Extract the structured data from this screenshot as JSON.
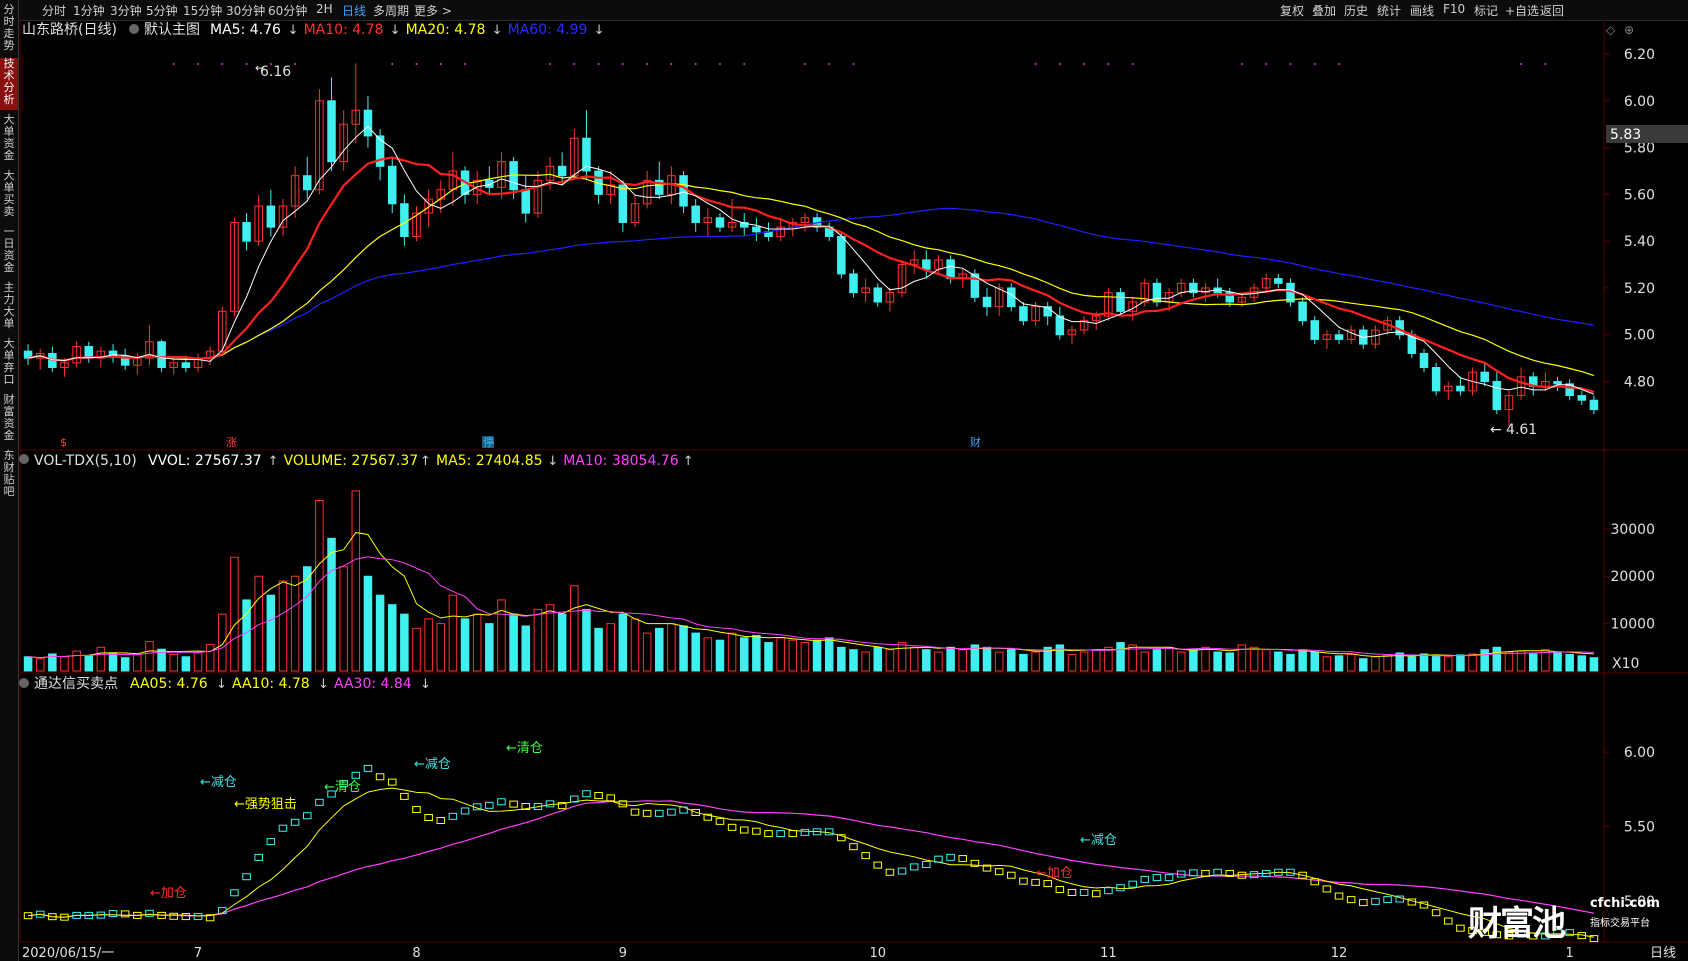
{
  "toolbar": {
    "timeframes": [
      "分时",
      "1分钟",
      "3分钟",
      "5分钟",
      "15分钟",
      "30分钟",
      "60分钟",
      "2H",
      "日线",
      "多周期",
      "更多 >"
    ],
    "active_timeframe": "日线",
    "right_buttons": [
      "复权",
      "叠加",
      "历史",
      "统计",
      "画线",
      "F10",
      "标记",
      "+自选",
      "返回"
    ]
  },
  "sidebar": {
    "tabs": [
      "分时走势",
      "技术分析",
      "大单资金",
      "大单买卖",
      "一日资金",
      "主力大单",
      "大单弃口",
      "财富资金",
      "东财贴吧"
    ],
    "active_tab": "技术分析"
  },
  "main_panel": {
    "stock_label": "山东路桥(日线)",
    "template": "默认主图",
    "indicators": [
      {
        "text": "MA5: 4.76",
        "arrow": "↓",
        "color": "#ffffff"
      },
      {
        "text": "MA10: 4.78",
        "arrow": "↓",
        "color": "#ff3030"
      },
      {
        "text": "MA20: 4.78",
        "arrow": "↓",
        "color": "#ffff00"
      },
      {
        "text": "MA60: 4.99",
        "arrow": "↓",
        "color": "#2b2bff"
      }
    ],
    "high_label": "6.16",
    "low_label": "4.61",
    "current_price": "5.83",
    "price_ticks": [
      "6.20",
      "6.00",
      "5.80",
      "5.60",
      "5.40",
      "5.20",
      "5.00",
      "4.80"
    ],
    "event_markers": [
      {
        "label": "$",
        "color": "#ff4040"
      },
      {
        "label": "涨",
        "color": "#ff4040"
      },
      {
        "label": "停",
        "color": "#40c0ff"
      },
      {
        "label": "财",
        "color": "#40a0ff"
      }
    ]
  },
  "volume_panel": {
    "title": "VOL-TDX(5,10)",
    "indicators": [
      {
        "text": "VVOL: 27567.37",
        "arrow": "↑",
        "color": "#ffffff"
      },
      {
        "text": "VOLUME: 27567.37",
        "arrow": "↑",
        "color": "#ffff00"
      },
      {
        "text": "MA5: 27404.85",
        "arrow": "↓",
        "color": "#ffff00"
      },
      {
        "text": "MA10: 38054.76",
        "arrow": "↑",
        "color": "#ff40ff"
      }
    ],
    "ticks": [
      "30000",
      "20000",
      "10000"
    ],
    "unit": "X10"
  },
  "signal_panel": {
    "title": "通达信买卖点",
    "indicators": [
      {
        "text": "AA05: 4.76",
        "arrow": "↓",
        "color": "#ffff00"
      },
      {
        "text": "AA10: 4.78",
        "arrow": "↓",
        "color": "#ffff00"
      },
      {
        "text": "AA30: 4.84",
        "arrow": "↓",
        "color": "#ff40ff"
      }
    ],
    "ticks": [
      "6.00",
      "5.50",
      "5.00"
    ],
    "annotations": [
      {
        "text": "←加仓",
        "color": "#ff3030"
      },
      {
        "text": "←减仓",
        "color": "#40e0e0"
      },
      {
        "text": "←强势狙击",
        "color": "#ffff00"
      },
      {
        "text": "←清仓",
        "color": "#40ff40"
      },
      {
        "text": "←减仓",
        "color": "#40e0e0"
      },
      {
        "text": "←清仓",
        "color": "#40ff40"
      },
      {
        "text": "←加仓",
        "color": "#ff3030"
      },
      {
        "text": "←减仓",
        "color": "#40e0e0"
      }
    ]
  },
  "x_axis": {
    "start_date": "2020/06/15/一",
    "month_labels": [
      "7",
      "8",
      "9",
      "10",
      "11",
      "12",
      "1"
    ],
    "period_label": "日线"
  },
  "watermark": {
    "brand": "财富池",
    "domain": "cfchi.com",
    "tagline": "指标交易平台"
  },
  "colors": {
    "up": "#ff3030",
    "down": "#40f0f0",
    "ma5": "#ffffff",
    "ma10": "#ff2020",
    "ma20": "#ffff00",
    "ma60": "#2020ff",
    "ma_vol10": "#ff40ff",
    "grid": "#5a0000"
  },
  "chart_data": {
    "type": "candlestick",
    "symbol_title": "山东路桥(日线)",
    "ohlc": [
      [
        4.93,
        4.96,
        4.87,
        4.9
      ],
      [
        4.9,
        4.94,
        4.85,
        4.92
      ],
      [
        4.92,
        4.95,
        4.84,
        4.86
      ],
      [
        4.86,
        4.9,
        4.82,
        4.88
      ],
      [
        4.88,
        4.97,
        4.86,
        4.95
      ],
      [
        4.95,
        4.97,
        4.88,
        4.9
      ],
      [
        4.9,
        4.95,
        4.86,
        4.93
      ],
      [
        4.93,
        4.96,
        4.88,
        4.91
      ],
      [
        4.91,
        4.94,
        4.85,
        4.87
      ],
      [
        4.87,
        4.92,
        4.83,
        4.9
      ],
      [
        4.9,
        5.04,
        4.87,
        4.97
      ],
      [
        4.97,
        4.98,
        4.84,
        4.86
      ],
      [
        4.86,
        4.9,
        4.83,
        4.88
      ],
      [
        4.88,
        4.91,
        4.84,
        4.86
      ],
      [
        4.86,
        4.92,
        4.84,
        4.9
      ],
      [
        4.9,
        4.95,
        4.87,
        4.93
      ],
      [
        4.93,
        5.12,
        4.91,
        5.1
      ],
      [
        5.1,
        5.5,
        5.08,
        5.48
      ],
      [
        5.48,
        5.52,
        5.36,
        5.4
      ],
      [
        5.4,
        5.6,
        5.38,
        5.55
      ],
      [
        5.55,
        5.62,
        5.42,
        5.46
      ],
      [
        5.46,
        5.58,
        5.42,
        5.55
      ],
      [
        5.55,
        5.72,
        5.5,
        5.68
      ],
      [
        5.68,
        5.76,
        5.58,
        5.62
      ],
      [
        5.62,
        6.05,
        5.6,
        6.0
      ],
      [
        6.0,
        6.1,
        5.7,
        5.74
      ],
      [
        5.74,
        5.96,
        5.7,
        5.9
      ],
      [
        5.9,
        6.16,
        5.82,
        5.96
      ],
      [
        5.96,
        6.02,
        5.8,
        5.85
      ],
      [
        5.85,
        5.88,
        5.66,
        5.72
      ],
      [
        5.72,
        5.76,
        5.52,
        5.56
      ],
      [
        5.56,
        5.6,
        5.38,
        5.42
      ],
      [
        5.42,
        5.55,
        5.4,
        5.52
      ],
      [
        5.52,
        5.62,
        5.46,
        5.58
      ],
      [
        5.58,
        5.66,
        5.52,
        5.62
      ],
      [
        5.62,
        5.78,
        5.55,
        5.7
      ],
      [
        5.7,
        5.72,
        5.56,
        5.6
      ],
      [
        5.6,
        5.7,
        5.56,
        5.66
      ],
      [
        5.66,
        5.72,
        5.6,
        5.63
      ],
      [
        5.63,
        5.78,
        5.58,
        5.74
      ],
      [
        5.74,
        5.76,
        5.58,
        5.62
      ],
      [
        5.62,
        5.68,
        5.48,
        5.52
      ],
      [
        5.52,
        5.7,
        5.5,
        5.66
      ],
      [
        5.66,
        5.76,
        5.62,
        5.72
      ],
      [
        5.72,
        5.78,
        5.64,
        5.68
      ],
      [
        5.68,
        5.88,
        5.66,
        5.84
      ],
      [
        5.84,
        5.96,
        5.66,
        5.7
      ],
      [
        5.7,
        5.72,
        5.56,
        5.6
      ],
      [
        5.6,
        5.7,
        5.56,
        5.64
      ],
      [
        5.64,
        5.66,
        5.44,
        5.48
      ],
      [
        5.48,
        5.6,
        5.46,
        5.56
      ],
      [
        5.56,
        5.7,
        5.54,
        5.66
      ],
      [
        5.66,
        5.74,
        5.58,
        5.6
      ],
      [
        5.6,
        5.72,
        5.56,
        5.68
      ],
      [
        5.68,
        5.7,
        5.52,
        5.55
      ],
      [
        5.55,
        5.58,
        5.44,
        5.48
      ],
      [
        5.48,
        5.54,
        5.42,
        5.5
      ],
      [
        5.5,
        5.52,
        5.44,
        5.46
      ],
      [
        5.46,
        5.58,
        5.44,
        5.48
      ],
      [
        5.48,
        5.52,
        5.42,
        5.46
      ],
      [
        5.46,
        5.5,
        5.4,
        5.44
      ],
      [
        5.44,
        5.48,
        5.4,
        5.42
      ],
      [
        5.42,
        5.5,
        5.4,
        5.46
      ],
      [
        5.46,
        5.5,
        5.42,
        5.48
      ],
      [
        5.48,
        5.52,
        5.44,
        5.5
      ],
      [
        5.5,
        5.52,
        5.44,
        5.46
      ],
      [
        5.46,
        5.48,
        5.4,
        5.42
      ],
      [
        5.42,
        5.44,
        5.24,
        5.26
      ],
      [
        5.26,
        5.28,
        5.16,
        5.18
      ],
      [
        5.18,
        5.24,
        5.14,
        5.2
      ],
      [
        5.2,
        5.22,
        5.12,
        5.14
      ],
      [
        5.14,
        5.2,
        5.1,
        5.18
      ],
      [
        5.18,
        5.32,
        5.16,
        5.3
      ],
      [
        5.3,
        5.36,
        5.26,
        5.32
      ],
      [
        5.32,
        5.36,
        5.24,
        5.28
      ],
      [
        5.28,
        5.34,
        5.26,
        5.32
      ],
      [
        5.32,
        5.34,
        5.22,
        5.24
      ],
      [
        5.24,
        5.28,
        5.2,
        5.26
      ],
      [
        5.26,
        5.28,
        5.14,
        5.16
      ],
      [
        5.16,
        5.2,
        5.08,
        5.12
      ],
      [
        5.12,
        5.22,
        5.08,
        5.2
      ],
      [
        5.2,
        5.22,
        5.1,
        5.12
      ],
      [
        5.12,
        5.14,
        5.04,
        5.06
      ],
      [
        5.06,
        5.14,
        5.04,
        5.12
      ],
      [
        5.12,
        5.14,
        5.04,
        5.08
      ],
      [
        5.08,
        5.12,
        4.98,
        5.0
      ],
      [
        5.0,
        5.04,
        4.96,
        5.02
      ],
      [
        5.02,
        5.08,
        5.0,
        5.06
      ],
      [
        5.06,
        5.1,
        5.02,
        5.08
      ],
      [
        5.08,
        5.2,
        5.06,
        5.18
      ],
      [
        5.18,
        5.2,
        5.08,
        5.1
      ],
      [
        5.1,
        5.16,
        5.06,
        5.14
      ],
      [
        5.14,
        5.24,
        5.12,
        5.22
      ],
      [
        5.22,
        5.24,
        5.12,
        5.14
      ],
      [
        5.14,
        5.2,
        5.1,
        5.18
      ],
      [
        5.18,
        5.24,
        5.16,
        5.22
      ],
      [
        5.22,
        5.24,
        5.16,
        5.18
      ],
      [
        5.18,
        5.22,
        5.14,
        5.2
      ],
      [
        5.2,
        5.24,
        5.16,
        5.18
      ],
      [
        5.18,
        5.2,
        5.12,
        5.14
      ],
      [
        5.14,
        5.18,
        5.12,
        5.16
      ],
      [
        5.16,
        5.22,
        5.14,
        5.2
      ],
      [
        5.2,
        5.26,
        5.18,
        5.24
      ],
      [
        5.24,
        5.26,
        5.2,
        5.22
      ],
      [
        5.22,
        5.24,
        5.12,
        5.14
      ],
      [
        5.14,
        5.16,
        5.04,
        5.06
      ],
      [
        5.06,
        5.08,
        4.96,
        4.98
      ],
      [
        4.98,
        5.02,
        4.94,
        5.0
      ],
      [
        5.0,
        5.02,
        4.96,
        4.98
      ],
      [
        4.98,
        5.04,
        4.96,
        5.02
      ],
      [
        5.02,
        5.04,
        4.94,
        4.96
      ],
      [
        4.96,
        5.04,
        4.94,
        5.02
      ],
      [
        5.02,
        5.08,
        5.0,
        5.06
      ],
      [
        5.06,
        5.08,
        4.98,
        5.0
      ],
      [
        5.0,
        5.02,
        4.9,
        4.92
      ],
      [
        4.92,
        4.94,
        4.84,
        4.86
      ],
      [
        4.86,
        4.88,
        4.74,
        4.76
      ],
      [
        4.76,
        4.8,
        4.72,
        4.78
      ],
      [
        4.78,
        4.82,
        4.74,
        4.76
      ],
      [
        4.76,
        4.86,
        4.74,
        4.84
      ],
      [
        4.84,
        4.88,
        4.78,
        4.8
      ],
      [
        4.8,
        4.84,
        4.66,
        4.68
      ],
      [
        4.68,
        4.76,
        4.61,
        4.74
      ],
      [
        4.74,
        4.86,
        4.72,
        4.82
      ],
      [
        4.82,
        4.84,
        4.74,
        4.78
      ],
      [
        4.78,
        4.84,
        4.76,
        4.8
      ],
      [
        4.8,
        4.82,
        4.76,
        4.79
      ],
      [
        4.79,
        4.81,
        4.72,
        4.74
      ],
      [
        4.74,
        4.76,
        4.7,
        4.72
      ],
      [
        4.72,
        4.74,
        4.66,
        4.68
      ]
    ],
    "volume": [
      3000,
      2600,
      3600,
      3000,
      4200,
      3200,
      5000,
      3800,
      2800,
      3400,
      6200,
      4600,
      3500,
      3000,
      3800,
      5600,
      12000,
      24000,
      15000,
      20000,
      16000,
      19000,
      20000,
      22000,
      36000,
      28000,
      22000,
      38000,
      20000,
      16000,
      14000,
      12000,
      9000,
      11000,
      10000,
      16000,
      11000,
      12000,
      10000,
      15000,
      12000,
      9500,
      13000,
      14000,
      12000,
      18000,
      13000,
      9000,
      10000,
      12000,
      11000,
      8000,
      9000,
      10000,
      9500,
      8000,
      7000,
      6500,
      8000,
      7000,
      7500,
      6000,
      7000,
      6500,
      6000,
      6500,
      7000,
      5000,
      4500,
      4000,
      5000,
      4500,
      6000,
      5000,
      4500,
      4000,
      5000,
      4500,
      5500,
      5000,
      4000,
      4500,
      3500,
      4000,
      5000,
      5500,
      3500,
      4000,
      4500,
      5000,
      6000,
      5500,
      4000,
      4500,
      5000,
      4000,
      4500,
      5000,
      4000,
      3800,
      5500,
      5000,
      4500,
      4000,
      3500,
      4500,
      4000,
      3000,
      3200,
      3500,
      2600,
      3000,
      3400,
      3800,
      3000,
      3600,
      3200,
      3000,
      3400,
      3600,
      4500,
      5000,
      4000,
      4200,
      3600,
      4500,
      4000,
      3500,
      3200,
      2800
    ],
    "series": [
      {
        "name": "MA5"
      },
      {
        "name": "MA10"
      },
      {
        "name": "MA20"
      },
      {
        "name": "MA60"
      }
    ],
    "ylim": [
      4.55,
      6.26
    ],
    "y_ticks": [
      6.2,
      6.0,
      5.8,
      5.6,
      5.4,
      5.2,
      5.0,
      4.8
    ],
    "volume_ylim": [
      0,
      42000
    ],
    "volume_ticks": [
      30000,
      20000,
      10000
    ],
    "signal_ylim": [
      4.75,
      6.35
    ],
    "signal_ticks": [
      6.0,
      5.5,
      5.0
    ],
    "x_labels": [
      "2020/06/15/一",
      "7",
      "8",
      "9",
      "10",
      "11",
      "12",
      "1"
    ]
  }
}
